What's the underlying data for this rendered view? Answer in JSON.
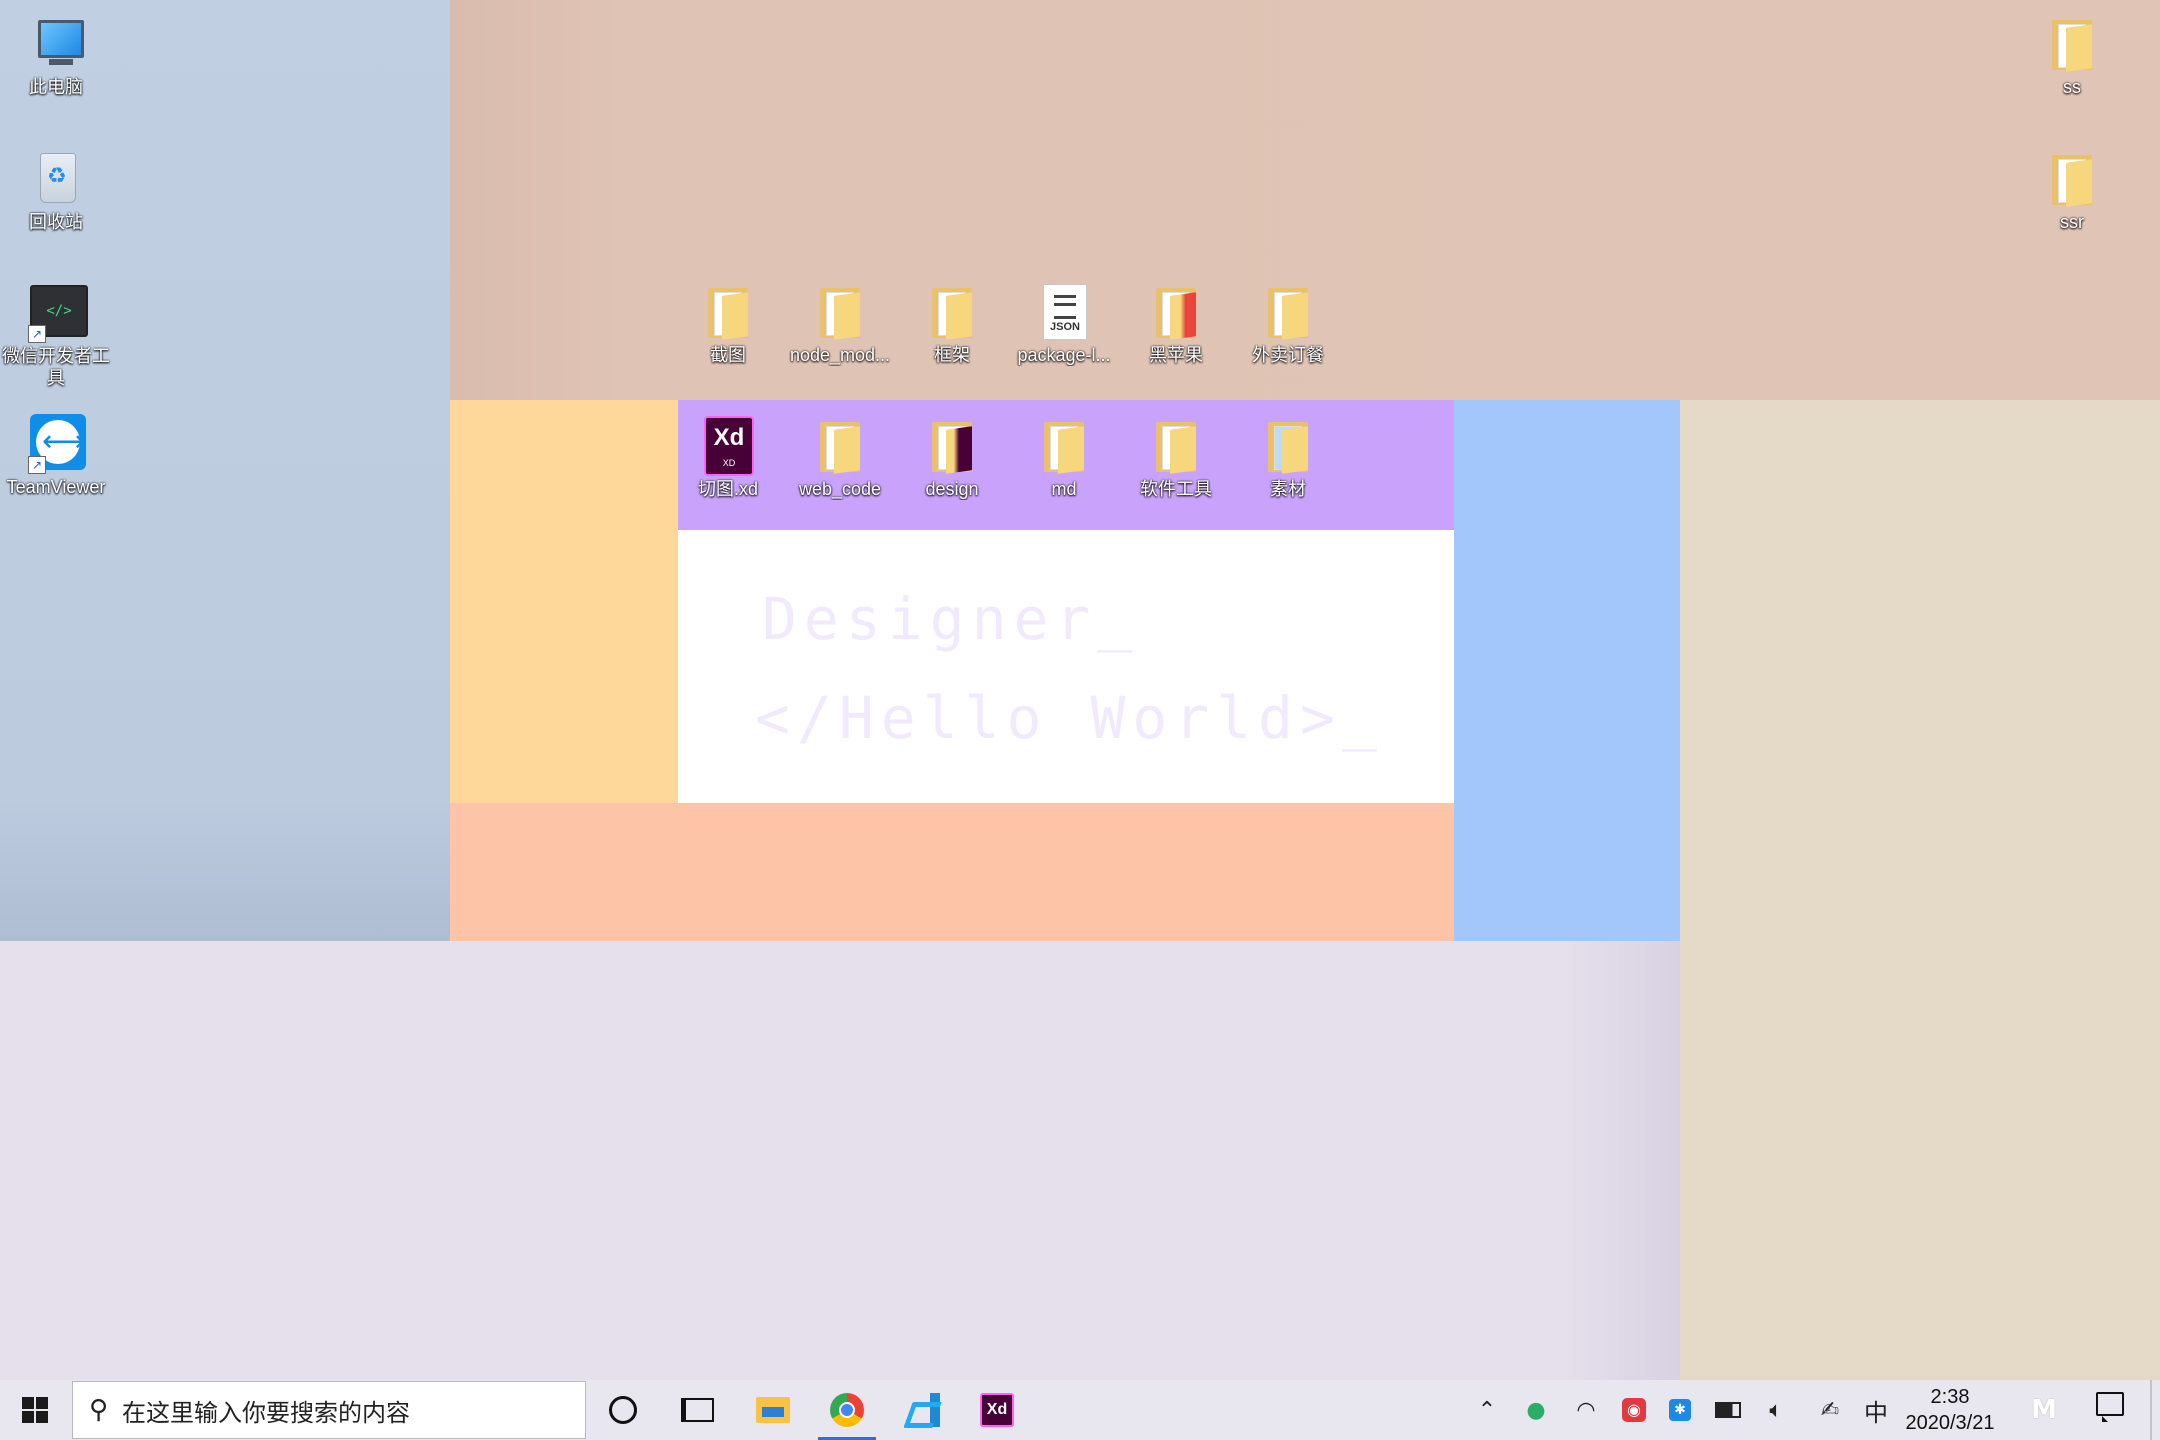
{
  "desktop": {
    "left_icons": [
      {
        "label": "此电脑",
        "icon": "computer-icon"
      },
      {
        "label": "回收站",
        "icon": "recycle-bin-icon"
      },
      {
        "label": "微信开发者工具",
        "icon": "wechat-devtools-icon"
      },
      {
        "label": "TeamViewer",
        "icon": "teamviewer-icon"
      }
    ],
    "right_icons": [
      {
        "label": "ss",
        "icon": "folder-icon"
      },
      {
        "label": "ssr",
        "icon": "folder-icon"
      }
    ],
    "row1": [
      {
        "label": "截图",
        "icon": "folder-icon"
      },
      {
        "label": "node_mod...",
        "icon": "folder-icon"
      },
      {
        "label": "框架",
        "icon": "folder-icon"
      },
      {
        "label": "package-l...",
        "icon": "json-file-icon",
        "badge": "JSON"
      },
      {
        "label": "黑苹果",
        "icon": "folder-icon"
      },
      {
        "label": "外卖订餐",
        "icon": "folder-icon"
      }
    ],
    "row2": [
      {
        "label": "切图.xd",
        "icon": "xd-file-icon",
        "badge": "Xd",
        "badge2": "XD"
      },
      {
        "label": "web_code",
        "icon": "folder-icon"
      },
      {
        "label": "design",
        "icon": "folder-icon"
      },
      {
        "label": "md",
        "icon": "folder-icon"
      },
      {
        "label": "软件工具",
        "icon": "folder-icon"
      },
      {
        "label": "素材",
        "icon": "folder-icon"
      }
    ],
    "wallpaper_text": [
      "Designer_",
      "</Hello World>_"
    ],
    "colors": {
      "left": "#c0cfe2",
      "top": "#e0c4b5",
      "yellow": "#fdd89a",
      "purple": "#c9a3fb",
      "white": "#ffffff",
      "peach": "#fec4a7",
      "blue": "#a3c7fb",
      "right": "#e4dac7",
      "bottom": "#e6e0ec"
    }
  },
  "taskbar": {
    "search_placeholder": "在这里输入你要搜索的内容",
    "devtool_glyph": "</>",
    "xd_label": "Xd",
    "ime": "中",
    "time": "2:38",
    "date": "2020/3/21",
    "tray_icons": [
      "chevron-up-icon",
      "wechat-icon",
      "wifi-icon",
      "netease-music-icon",
      "bluetooth-icon",
      "battery-icon",
      "volume-icon",
      "pen-icon"
    ]
  }
}
